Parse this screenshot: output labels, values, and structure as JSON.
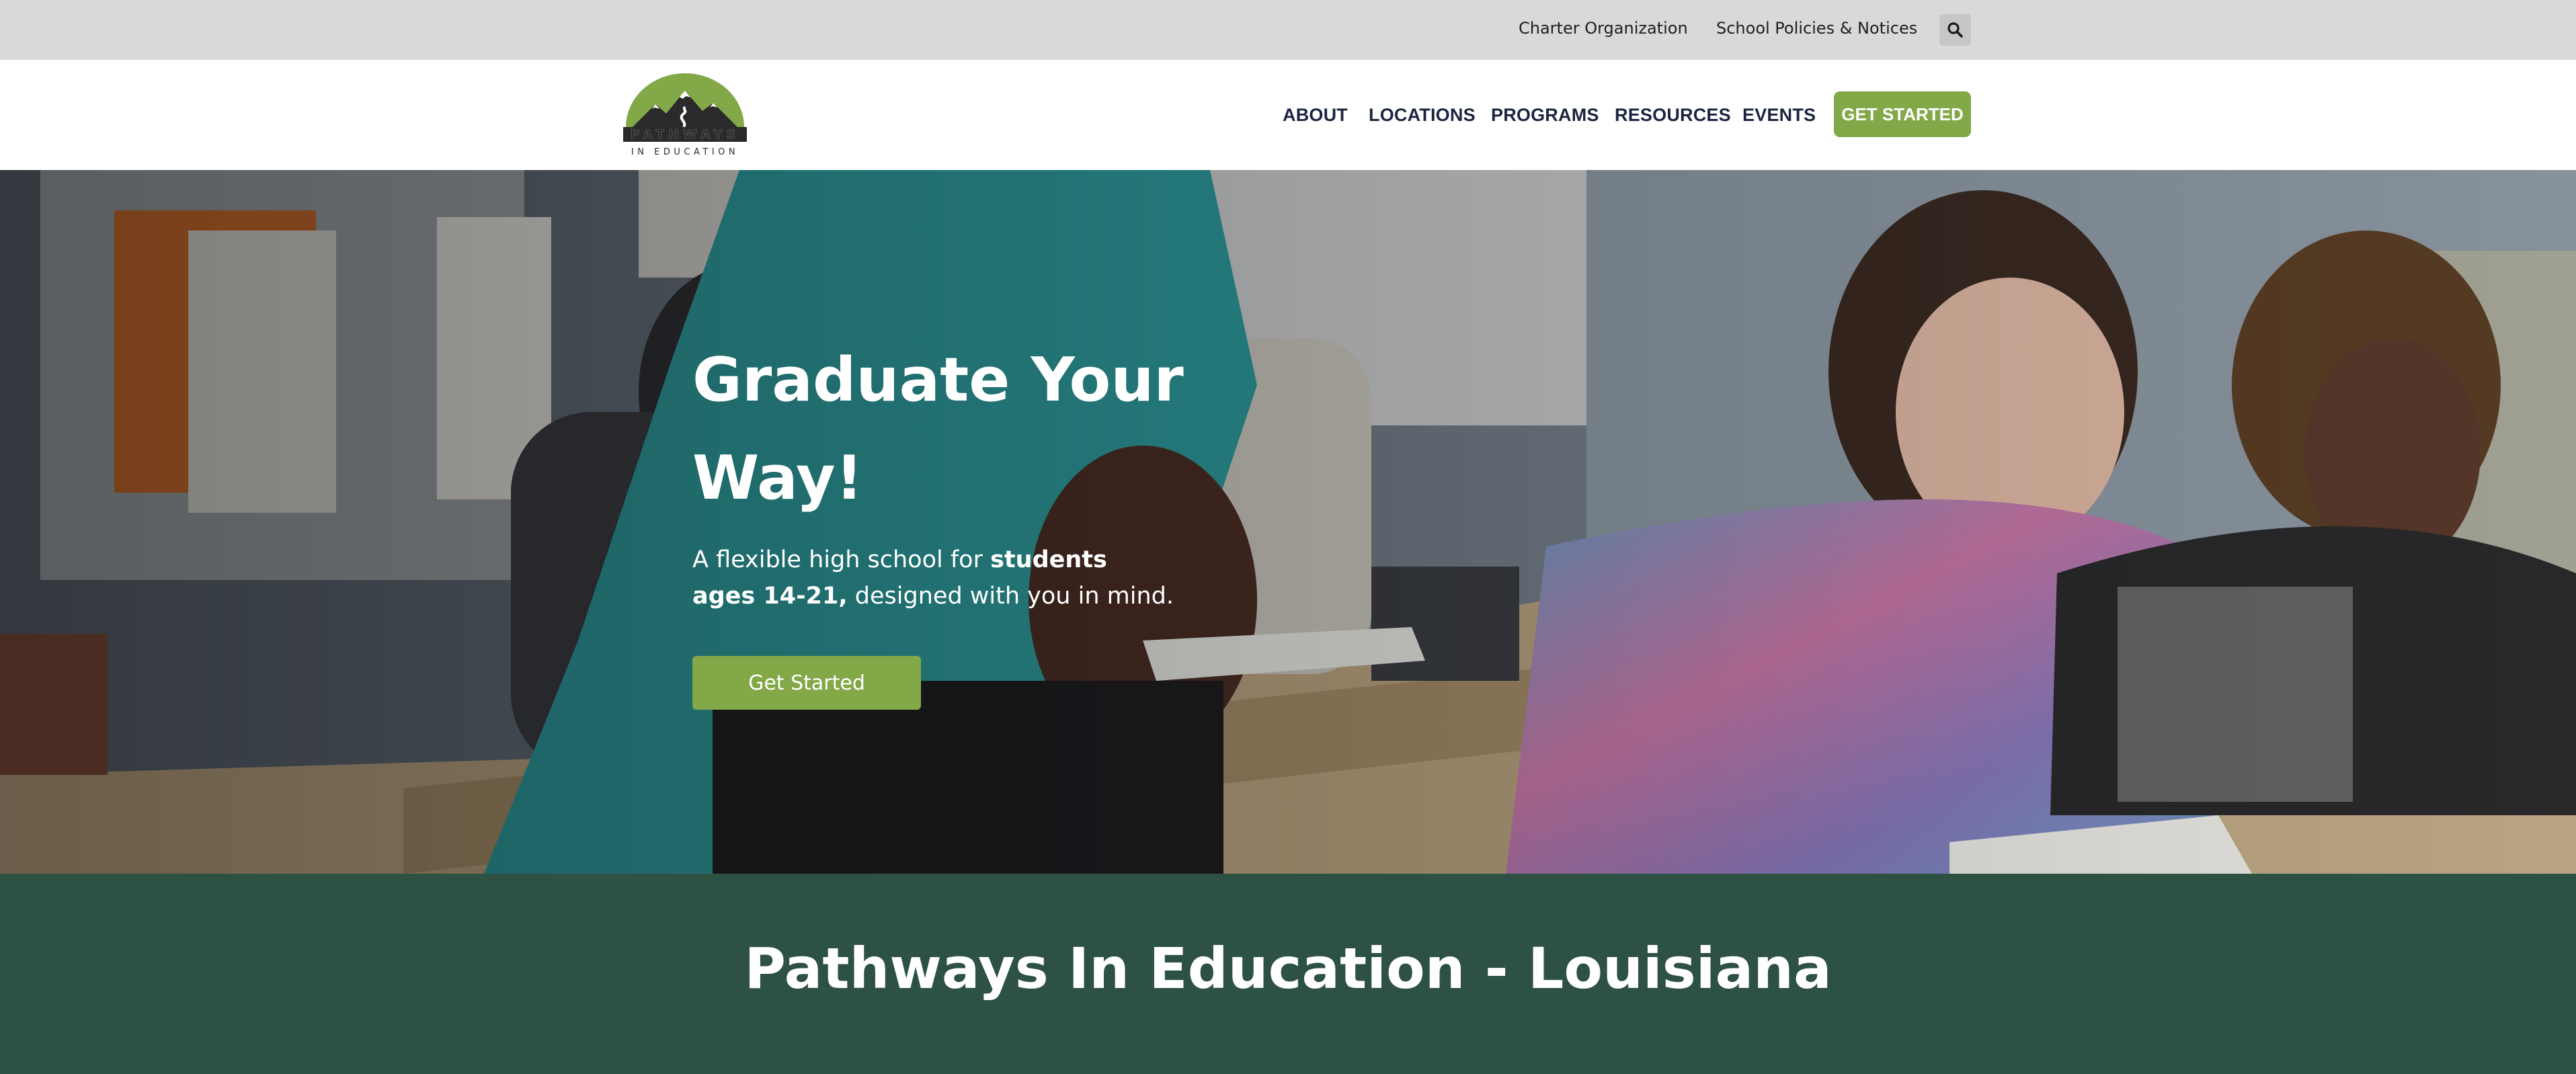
{
  "utility_bar": {
    "links": [
      "Charter Organization",
      "School Policies & Notices"
    ],
    "search_icon": "search-icon"
  },
  "header": {
    "logo": {
      "wordmark": "PATHWAYS",
      "tagline": "IN EDUCATION",
      "icon": "mountain-logo-icon"
    },
    "nav": {
      "about": "ABOUT",
      "locations": "LOCATIONS",
      "programs": "PROGRAMS",
      "resources": "RESOURCES",
      "events": "EVENTS",
      "cta": "GET STARTED"
    }
  },
  "hero": {
    "title_line1": "Graduate Your",
    "title_line2": "Way!",
    "subtitle_pre": "A flexible high school for ",
    "subtitle_bold": "students ages 14-21,",
    "subtitle_post": " designed with you in mind.",
    "cta": "Get Started"
  },
  "section": {
    "title": "Pathways In Education - Louisiana"
  },
  "colors": {
    "utility_bg": "#d9d9d9",
    "nav_text": "#1c2440",
    "accent_green": "#82a848",
    "band_green": "#2d5143"
  }
}
